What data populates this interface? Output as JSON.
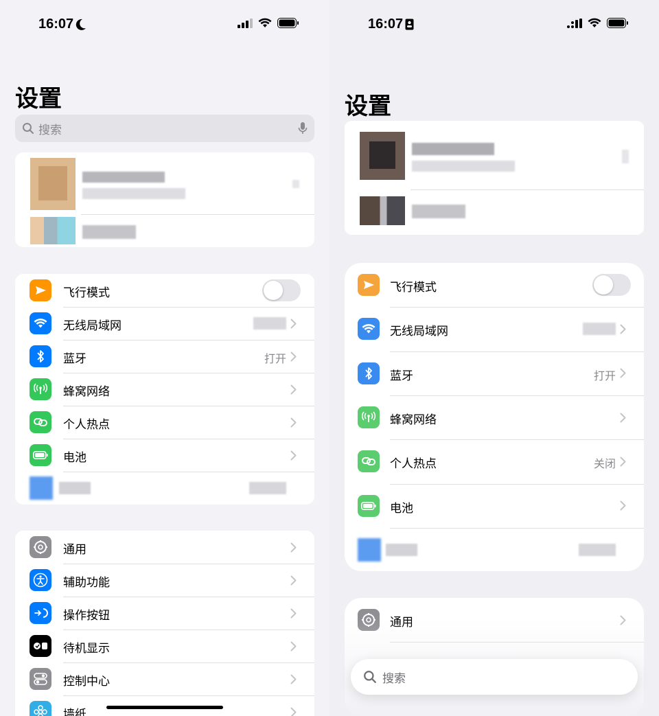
{
  "left": {
    "status": {
      "time": "16:07",
      "focus_icon": "moon-icon"
    },
    "title": "设置",
    "search": {
      "placeholder": "搜索"
    },
    "rows_group1": [
      {
        "label": "飞行模式",
        "icon": "airplane-icon",
        "color": "#ff9500",
        "value": "",
        "control": "toggle"
      },
      {
        "label": "无线局域网",
        "icon": "wifi-icon",
        "color": "#007aff",
        "value": "",
        "control": "chevron"
      },
      {
        "label": "蓝牙",
        "icon": "bluetooth-icon",
        "color": "#007aff",
        "value": "打开",
        "control": "chevron"
      },
      {
        "label": "蜂窝网络",
        "icon": "cellular-icon",
        "color": "#34c759",
        "value": "",
        "control": "chevron"
      },
      {
        "label": "个人热点",
        "icon": "hotspot-icon",
        "color": "#34c759",
        "value": "",
        "control": "chevron"
      },
      {
        "label": "电池",
        "icon": "battery-icon",
        "color": "#34c759",
        "value": "",
        "control": "chevron"
      }
    ],
    "rows_group2": [
      {
        "label": "通用",
        "icon": "gear-icon",
        "color": "#8e8e93"
      },
      {
        "label": "辅助功能",
        "icon": "accessibility-icon",
        "color": "#007aff"
      },
      {
        "label": "操作按钮",
        "icon": "action-button-icon",
        "color": "#007aff"
      },
      {
        "label": "待机显示",
        "icon": "standby-icon",
        "color": "#000000"
      },
      {
        "label": "控制中心",
        "icon": "control-center-icon",
        "color": "#8e8e93"
      },
      {
        "label": "墙纸",
        "icon": "wallpaper-icon",
        "color": "#32ade6"
      }
    ]
  },
  "right": {
    "status": {
      "time": "16:07",
      "focus_icon": "badge-icon"
    },
    "title": "设置",
    "rows_group1": [
      {
        "label": "飞行模式",
        "icon": "airplane-icon",
        "color": "#f5a33b",
        "value": "",
        "control": "toggle"
      },
      {
        "label": "无线局域网",
        "icon": "wifi-icon",
        "color": "#3a8bf0",
        "value": "",
        "control": "chevron"
      },
      {
        "label": "蓝牙",
        "icon": "bluetooth-icon",
        "color": "#3a8bf0",
        "value": "打开",
        "control": "chevron"
      },
      {
        "label": "蜂窝网络",
        "icon": "cellular-icon",
        "color": "#5ccd6f",
        "value": "",
        "control": "chevron"
      },
      {
        "label": "个人热点",
        "icon": "hotspot-icon",
        "color": "#5ccd6f",
        "value": "关闭",
        "control": "chevron"
      },
      {
        "label": "电池",
        "icon": "battery-icon",
        "color": "#5ccd6f",
        "value": "",
        "control": "chevron"
      }
    ],
    "rows_group2": [
      {
        "label": "通用",
        "icon": "gear-icon",
        "color": "#8e8e93"
      }
    ],
    "floating_search": {
      "placeholder": "搜索"
    }
  }
}
